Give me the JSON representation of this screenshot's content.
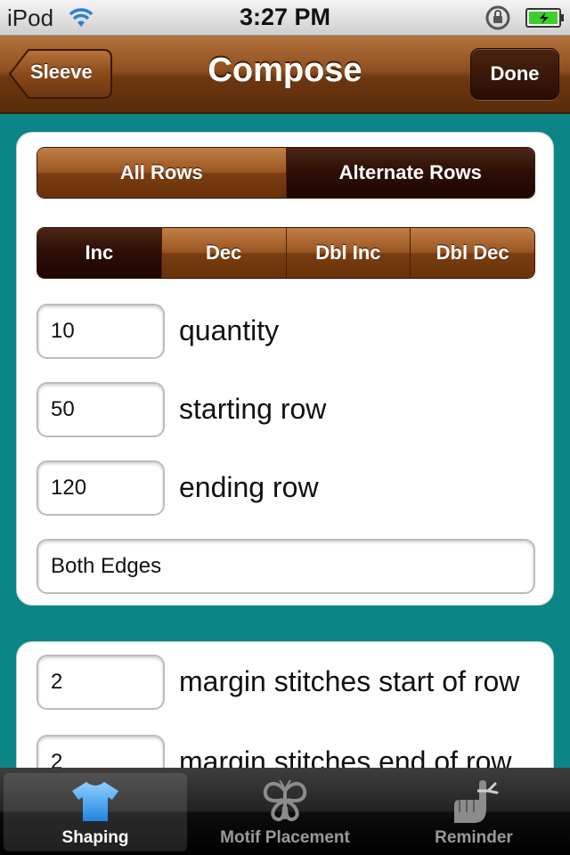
{
  "status_bar": {
    "carrier": "iPod",
    "time": "3:27 PM"
  },
  "nav": {
    "back_label": "Sleeve",
    "title": "Compose",
    "done_label": "Done"
  },
  "row_mode": {
    "options": [
      "All Rows",
      "Alternate Rows"
    ],
    "selected": "Alternate Rows"
  },
  "operation": {
    "options": [
      "Inc",
      "Dec",
      "Dbl Inc",
      "Dbl Dec"
    ],
    "selected": "Inc"
  },
  "fields": {
    "quantity": {
      "value": "10",
      "label": "quantity"
    },
    "starting_row": {
      "value": "50",
      "label": "starting row"
    },
    "ending_row": {
      "value": "120",
      "label": "ending row"
    },
    "edges": {
      "value": "Both Edges"
    },
    "margin_start": {
      "value": "2",
      "label": "margin stitches start of row"
    },
    "margin_end": {
      "value": "2",
      "label": "margin stitches end of row"
    }
  },
  "tabs": [
    {
      "label": "Shaping",
      "icon": "shirt-icon",
      "selected": true
    },
    {
      "label": "Motif Placement",
      "icon": "butterfly-icon",
      "selected": false
    },
    {
      "label": "Reminder",
      "icon": "finger-string-icon",
      "selected": false
    }
  ],
  "colors": {
    "background": "#0b8585",
    "nav_brown": "#8f5020",
    "selected_segment": "#2c0e05",
    "battery": "#3ccf2c"
  }
}
